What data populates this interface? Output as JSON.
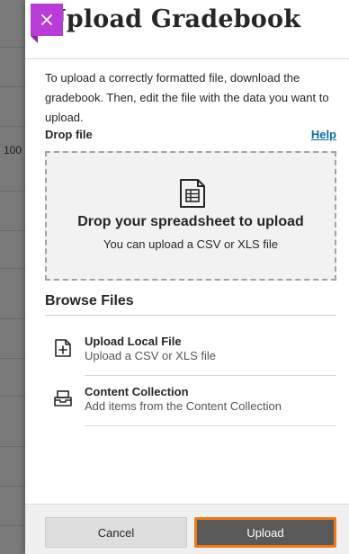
{
  "background": {
    "cell_value": "100"
  },
  "panel": {
    "title": "Upload Gradebook",
    "close_icon": "close-icon",
    "intro": "To upload a correctly formatted file, download the gradebook. Then, edit the file with the data you want to upload.",
    "drop_label": "Drop file",
    "help_link": "Help",
    "drop_zone": {
      "icon": "spreadsheet-icon",
      "title": "Drop your spreadsheet to upload",
      "subtitle": "You can upload a CSV or XLS file"
    },
    "browse": {
      "title": "Browse Files",
      "options": [
        {
          "icon": "upload-file-icon",
          "title": "Upload Local File",
          "subtitle": "Upload a CSV or XLS file"
        },
        {
          "icon": "content-collection-icon",
          "title": "Content Collection",
          "subtitle": "Add items from the Content Collection"
        }
      ]
    },
    "footer": {
      "cancel_label": "Cancel",
      "upload_label": "Upload"
    }
  },
  "colors": {
    "accent": "#b93cd6",
    "link": "#0b6ea8",
    "upload_button": "#595959",
    "focus_outline": "#ef7a1a"
  }
}
